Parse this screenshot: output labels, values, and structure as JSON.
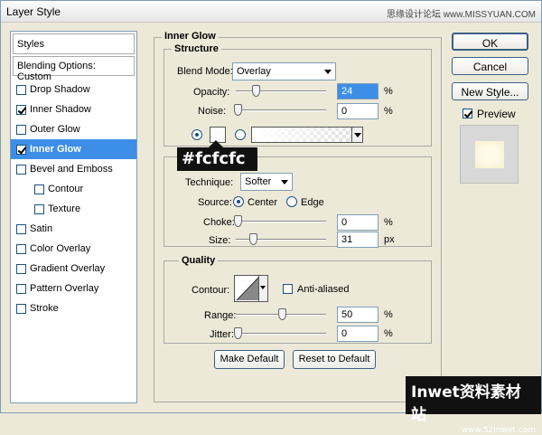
{
  "window": {
    "title": "Layer Style",
    "watermark": "思缘设计论坛 www.MISSYUAN.COM"
  },
  "sidebar": {
    "header": "Styles",
    "blending": "Blending Options: Custom",
    "items": [
      {
        "label": "Drop Shadow",
        "checked": false,
        "sub": false,
        "selected": false
      },
      {
        "label": "Inner Shadow",
        "checked": true,
        "sub": false,
        "selected": false
      },
      {
        "label": "Outer Glow",
        "checked": false,
        "sub": false,
        "selected": false
      },
      {
        "label": "Inner Glow",
        "checked": true,
        "sub": false,
        "selected": true
      },
      {
        "label": "Bevel and Emboss",
        "checked": false,
        "sub": false,
        "selected": false
      },
      {
        "label": "Contour",
        "checked": false,
        "sub": true,
        "selected": false
      },
      {
        "label": "Texture",
        "checked": false,
        "sub": true,
        "selected": false
      },
      {
        "label": "Satin",
        "checked": false,
        "sub": false,
        "selected": false
      },
      {
        "label": "Color Overlay",
        "checked": false,
        "sub": false,
        "selected": false
      },
      {
        "label": "Gradient Overlay",
        "checked": false,
        "sub": false,
        "selected": false
      },
      {
        "label": "Pattern Overlay",
        "checked": false,
        "sub": false,
        "selected": false
      },
      {
        "label": "Stroke",
        "checked": false,
        "sub": false,
        "selected": false
      }
    ]
  },
  "inner_glow": {
    "title": "Inner Glow",
    "structure": {
      "title": "Structure",
      "blend_mode_label": "Blend Mode:",
      "blend_mode_value": "Overlay",
      "opacity_label": "Opacity:",
      "opacity_value": "24",
      "opacity_unit": "%",
      "noise_label": "Noise:",
      "noise_value": "0",
      "noise_unit": "%",
      "color": "#fcfcfc",
      "callout": "#fcfcfc"
    },
    "elements": {
      "technique_label": "Technique:",
      "technique_value": "Softer",
      "source_label": "Source:",
      "source_center": "Center",
      "source_edge": "Edge",
      "choke_label": "Choke:",
      "choke_value": "0",
      "choke_unit": "%",
      "size_label": "Size:",
      "size_value": "31",
      "size_unit": "px"
    },
    "quality": {
      "title": "Quality",
      "contour_label": "Contour:",
      "anti_aliased_label": "Anti-aliased",
      "range_label": "Range:",
      "range_value": "50",
      "range_unit": "%",
      "jitter_label": "Jitter:",
      "jitter_value": "0",
      "jitter_unit": "%"
    },
    "make_default": "Make Default",
    "reset_default": "Reset to Default"
  },
  "buttons": {
    "ok": "OK",
    "cancel": "Cancel",
    "new_style": "New Style...",
    "preview": "Preview"
  },
  "logo": {
    "main": "Inwet资料素材站",
    "sub": "www.52inwet.com"
  }
}
